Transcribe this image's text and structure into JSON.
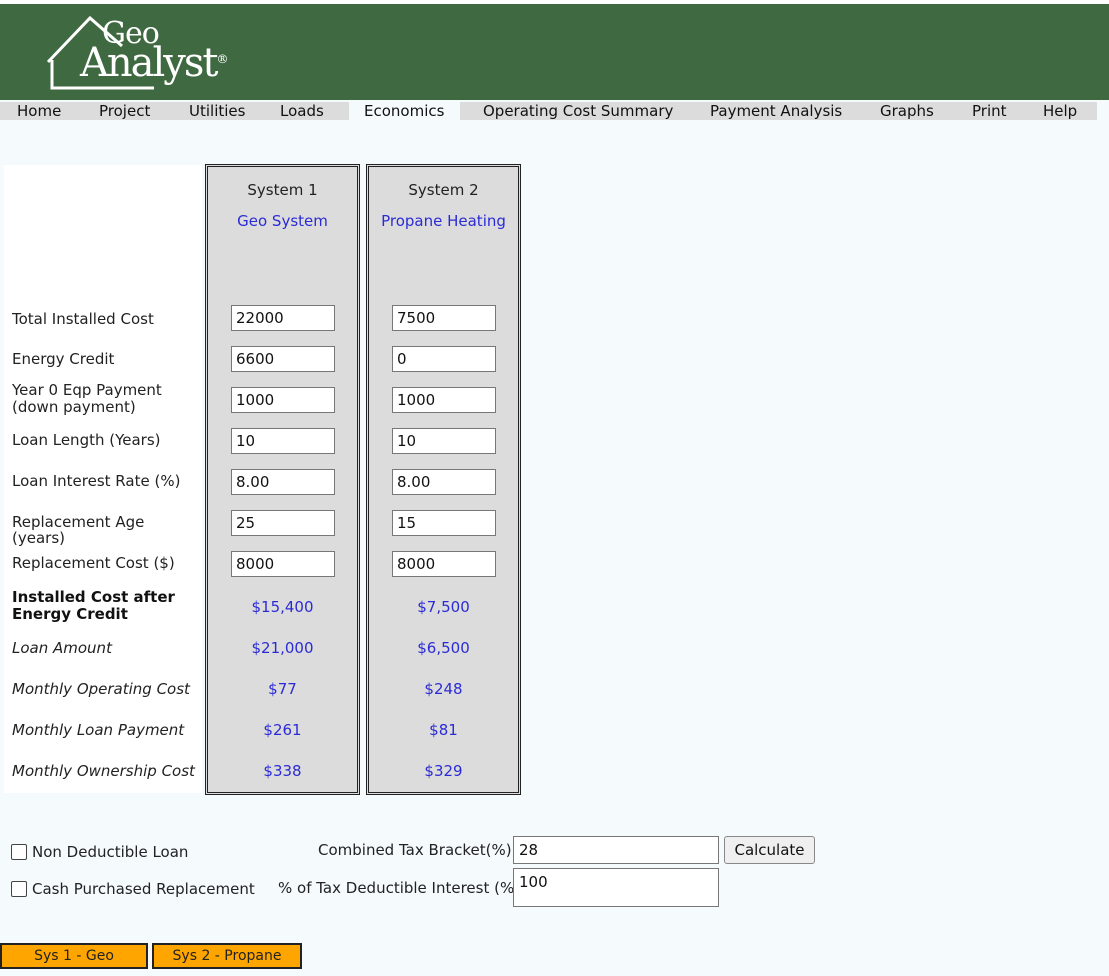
{
  "logo": {
    "line1": "Geo",
    "line2": "Analyst",
    "mark": "®",
    "icon": "house-outline-icon"
  },
  "nav": [
    {
      "label": "Home",
      "active": false
    },
    {
      "label": "Project",
      "active": false
    },
    {
      "label": "Utilities",
      "active": false
    },
    {
      "label": "Loads",
      "active": false
    },
    {
      "label": "Economics",
      "active": true
    },
    {
      "label": "Operating Cost Summary",
      "active": false
    },
    {
      "label": "Payment Analysis",
      "active": false
    },
    {
      "label": "Graphs",
      "active": false
    },
    {
      "label": "Print",
      "active": false
    },
    {
      "label": "Help",
      "active": false
    }
  ],
  "labels": {
    "total_installed_cost": "Total Installed Cost",
    "energy_credit": "Energy Credit",
    "year0_line1": "Year 0 Eqp Payment",
    "year0_line2": "(down payment)",
    "loan_length": "Loan Length (Years)",
    "loan_interest": "Loan Interest Rate (%)",
    "replacement_age": "Replacement Age (years)",
    "replacement_cost": "Replacement Cost ($)",
    "installed_after_line1": "Installed Cost after",
    "installed_after_line2": "Energy Credit",
    "loan_amount": "Loan Amount",
    "monthly_operating": "Monthly Operating Cost",
    "monthly_loan": "Monthly Loan Payment",
    "monthly_ownership": "Monthly Ownership Cost"
  },
  "systems": [
    {
      "title": "System 1",
      "name": "Geo System",
      "inputs": {
        "total_installed_cost": "22000",
        "energy_credit": "6600",
        "year0_payment": "1000",
        "loan_length": "10",
        "loan_interest": "8.00",
        "replacement_age": "25",
        "replacement_cost": "8000"
      },
      "results": {
        "installed_after_credit": "$15,400",
        "loan_amount": "$21,000",
        "monthly_operating": "$77",
        "monthly_loan": "$261",
        "monthly_ownership": "$338"
      }
    },
    {
      "title": "System 2",
      "name": "Propane Heating",
      "inputs": {
        "total_installed_cost": "7500",
        "energy_credit": "0",
        "year0_payment": "1000",
        "loan_length": "10",
        "loan_interest": "8.00",
        "replacement_age": "15",
        "replacement_cost": "8000"
      },
      "results": {
        "installed_after_credit": "$7,500",
        "loan_amount": "$6,500",
        "monthly_operating": "$248",
        "monthly_loan": "$81",
        "monthly_ownership": "$329"
      }
    }
  ],
  "options": {
    "non_deductible_label": "Non Deductible Loan",
    "non_deductible_checked": false,
    "cash_purchased_label": "Cash Purchased Replacement",
    "cash_purchased_checked": false,
    "tax_bracket_label": "Combined Tax Bracket(%)",
    "tax_bracket_value": "28",
    "deductible_interest_label": "% of Tax Deductible Interest (%)",
    "deductible_interest_value": "100",
    "calculate_label": "Calculate"
  },
  "bottom_buttons": [
    "Sys 1 - Geo",
    "Sys 2 - Propane"
  ],
  "colors": {
    "banner": "#3f6940",
    "value_blue": "#2b2bd6",
    "button_orange": "#ffa500",
    "column_gray": "#dcdcdc"
  }
}
